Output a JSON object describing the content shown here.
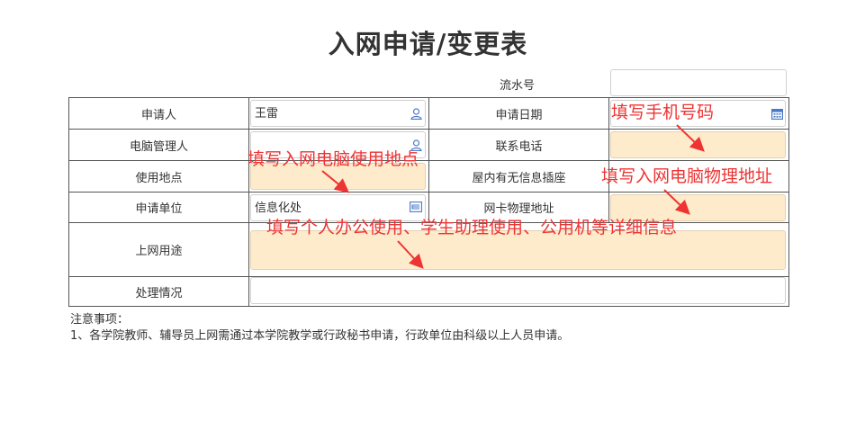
{
  "title": "入网申请/变更表",
  "serial": {
    "label": "流水号",
    "value": ""
  },
  "rows": {
    "applicant": {
      "label": "申请人",
      "value": "王雷"
    },
    "apply_date": {
      "label": "申请日期",
      "value": ""
    },
    "pc_manager": {
      "label": "电脑管理人",
      "value": ""
    },
    "phone": {
      "label": "联系电话",
      "value": ""
    },
    "location": {
      "label": "使用地点",
      "value": ""
    },
    "info_socket": {
      "label": "屋内有无信息插座",
      "value": ""
    },
    "unit": {
      "label": "申请单位",
      "value": "信息化处"
    },
    "mac": {
      "label": "网卡物理地址",
      "value": ""
    },
    "purpose": {
      "label": "上网用途",
      "value": ""
    },
    "handling": {
      "label": "处理情况",
      "value": ""
    }
  },
  "annotations": {
    "phone_hint": "填写手机号码",
    "location_hint": "填写入网电脑使用地点",
    "mac_hint": "填写入网电脑物理地址",
    "purpose_hint": "填写个人办公使用、学生助理使用、公用机等详细信息"
  },
  "notes": {
    "title": "注意事项：",
    "items": [
      "1、各学院教师、辅导员上网需通过本学院教学或行政秘书申请，行政单位由科级以上人员申请。"
    ]
  },
  "colors": {
    "highlight": "#fdebcb",
    "annotation": "#ee3333",
    "icon": "#4a79c7",
    "border": "#555555"
  },
  "icons": {
    "person_picker": "user-icon",
    "date_picker": "calendar-icon",
    "unit_picker": "org-picker-icon"
  }
}
